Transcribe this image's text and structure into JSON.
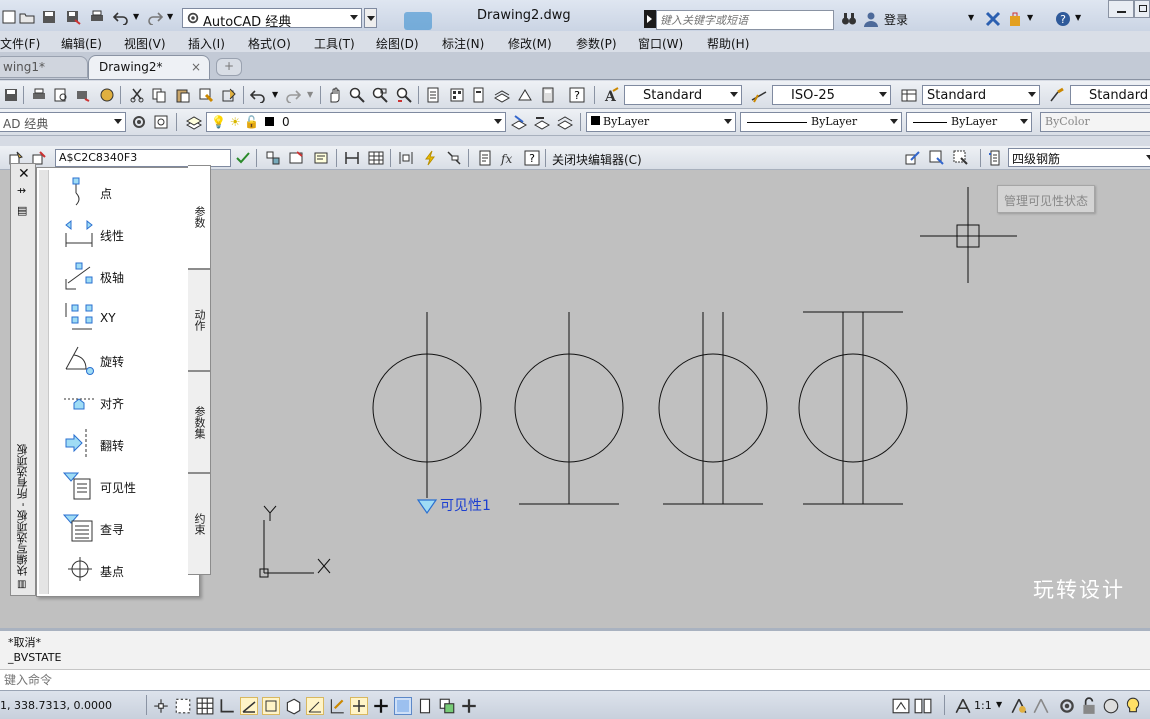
{
  "title_bar": {
    "workspace": "AutoCAD 经典",
    "document_title": "Drawing2.dwg",
    "search_placeholder": "键入关键字或短语",
    "login": "登录"
  },
  "menu": [
    "文件(F)",
    "编辑(E)",
    "视图(V)",
    "插入(I)",
    "格式(O)",
    "工具(T)",
    "绘图(D)",
    "标注(N)",
    "修改(M)",
    "参数(P)",
    "窗口(W)",
    "帮助(H)"
  ],
  "tabs": [
    {
      "label": "wing1*",
      "active": false
    },
    {
      "label": "Drawing2*",
      "active": true
    }
  ],
  "styles_toolbar": {
    "text_style": "Standard",
    "dim_style": "ISO-25",
    "table_style": "Standard",
    "mleader_style": "Standard"
  },
  "layers_toolbar": {
    "workspace_combo": "AD 经典",
    "layer": "0",
    "color": "ByLayer",
    "linetype": "ByLayer",
    "lineweight": "ByLayer",
    "plotstyle": "ByColor"
  },
  "block_editor_bar": {
    "block_name": "A$C2C8340F3",
    "close_label": "关闭块编辑器(C)",
    "visibility_state": "四级钢筋"
  },
  "tooltip": "管理可见性状态",
  "palette": {
    "title": "块编写选项板 - 所有选项板",
    "items": [
      "点",
      "线性",
      "极轴",
      "XY",
      "旋转",
      "对齐",
      "翻转",
      "可见性",
      "查寻",
      "基点"
    ],
    "tabs": [
      "参数",
      "动作",
      "参数集",
      "约束"
    ]
  },
  "drawing": {
    "parameter_label": "可见性1",
    "ucs_x": "X",
    "ucs_y": "Y",
    "watermark": "玩转设计"
  },
  "command": {
    "history": [
      "*取消*",
      "_BVSTATE"
    ],
    "placeholder": "键入命令"
  },
  "status_bar": {
    "coordinates": "1,  338.7313,  0.0000",
    "annotation_scale": "1:1"
  }
}
